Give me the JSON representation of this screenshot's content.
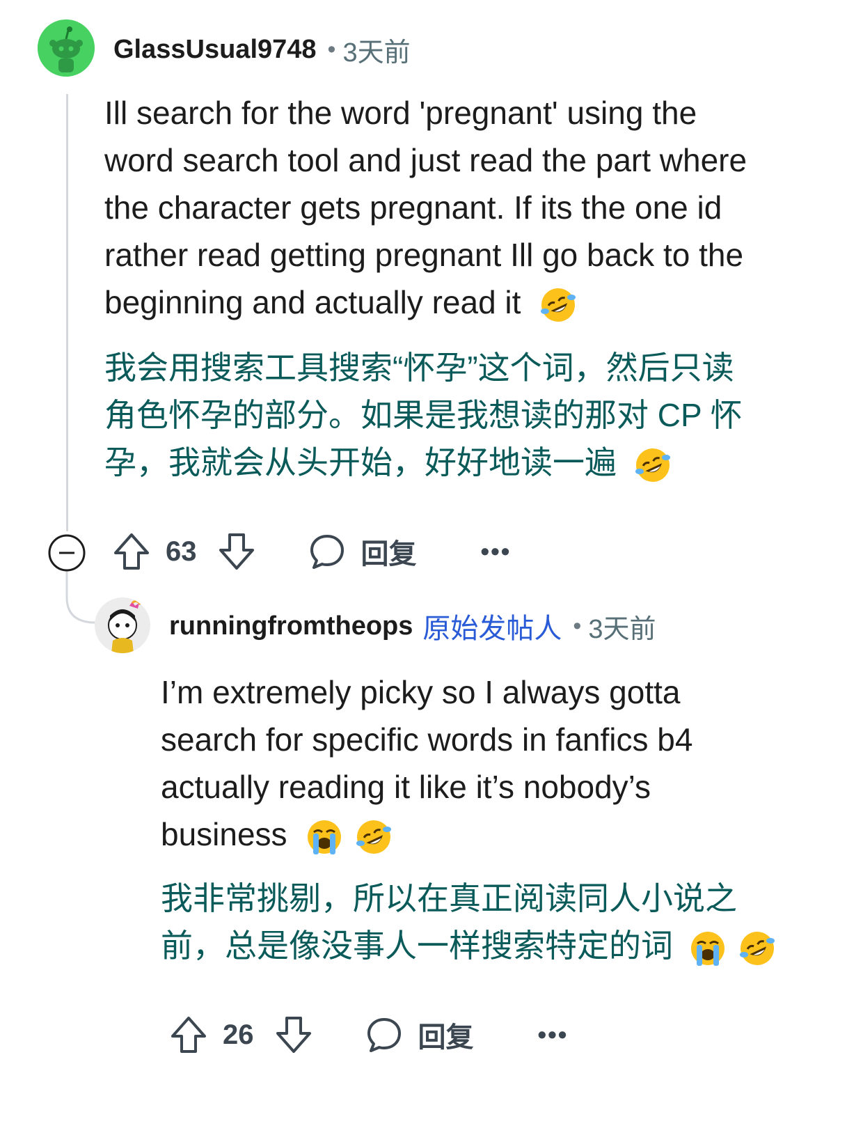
{
  "comments": [
    {
      "username": "GlassUsual9748",
      "separator": "•",
      "time": "3天前",
      "body_lines": [
        "Ill search for the word 'pregnant' using the",
        "word search tool and just read the part where",
        "the character gets pregnant. If its the one id",
        "rather read getting pregnant Ill go back to the",
        "beginning and actually read it"
      ],
      "translation_lines": [
        "我会用搜索工具搜索“怀孕”这个词，然后只读",
        "角色怀孕的部分。如果是我想读的那对 CP 怀",
        "孕，我就会从头开始，好好地读一遍"
      ],
      "votes": "63",
      "reply_label": "回复",
      "more_label": "•••",
      "emoji": [
        "rolling-on-floor-laughing"
      ]
    },
    {
      "username": "runningfromtheops",
      "op_tag": "原始发帖人",
      "separator": "•",
      "time": "3天前",
      "body_lines": [
        "I’m extremely picky so I always gotta",
        "search for specific words in fanfics b4",
        "actually reading it like it’s nobody’s",
        "business"
      ],
      "translation_lines": [
        "我非常挑剔，所以在真正阅读同人小说之",
        "前，总是像没事人一样搜索特定的词"
      ],
      "votes": "26",
      "reply_label": "回复",
      "more_label": "•••",
      "emoji": [
        "loudly-crying-face",
        "rolling-on-floor-laughing"
      ]
    }
  ],
  "colors": {
    "translation": "#0a5a5a",
    "op_tag": "#2a5bd7",
    "thread_line": "#d4d8dc",
    "avatar_bg": "#46d160"
  }
}
